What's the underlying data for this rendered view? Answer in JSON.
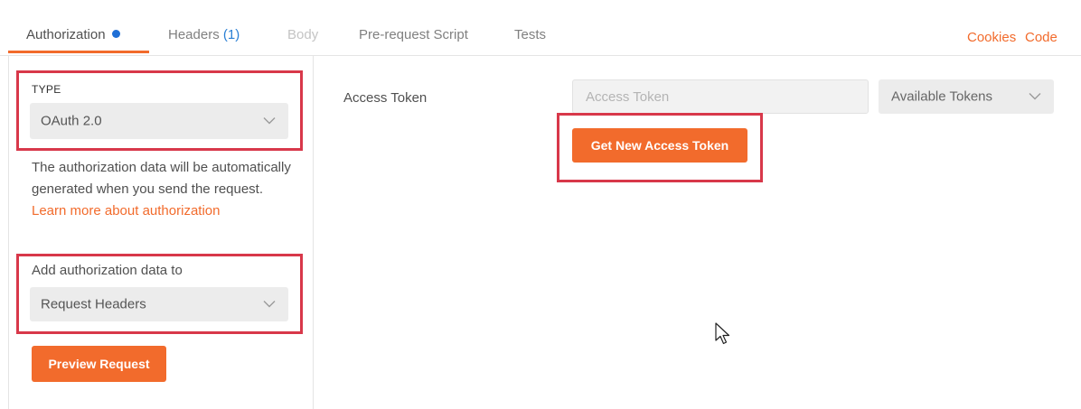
{
  "tabs": [
    {
      "label": "Authorization",
      "state": "active"
    },
    {
      "label": "Headers",
      "count": "(1)",
      "state": "normal"
    },
    {
      "label": "Body",
      "state": "disabled"
    },
    {
      "label": "Pre-request Script",
      "state": "normal"
    },
    {
      "label": "Tests",
      "state": "normal"
    }
  ],
  "toplinks": {
    "cookies": "Cookies",
    "code": "Code"
  },
  "sidebar": {
    "type_label": "TYPE",
    "type_value": "OAuth 2.0",
    "description": "The authorization data will be automatically generated when you send the request.",
    "learn_more": "Learn more about authorization",
    "add_to_label": "Add authorization data to",
    "add_to_value": "Request Headers",
    "preview_button": "Preview Request"
  },
  "main": {
    "access_token_label": "Access Token",
    "access_token_placeholder": "Access Token",
    "available_tokens": "Available Tokens",
    "get_token_button": "Get New Access Token"
  },
  "colors": {
    "accent": "#f26b2c",
    "highlight": "#d8384a",
    "dot": "#1f6fd6",
    "count": "#2a7fd4"
  }
}
